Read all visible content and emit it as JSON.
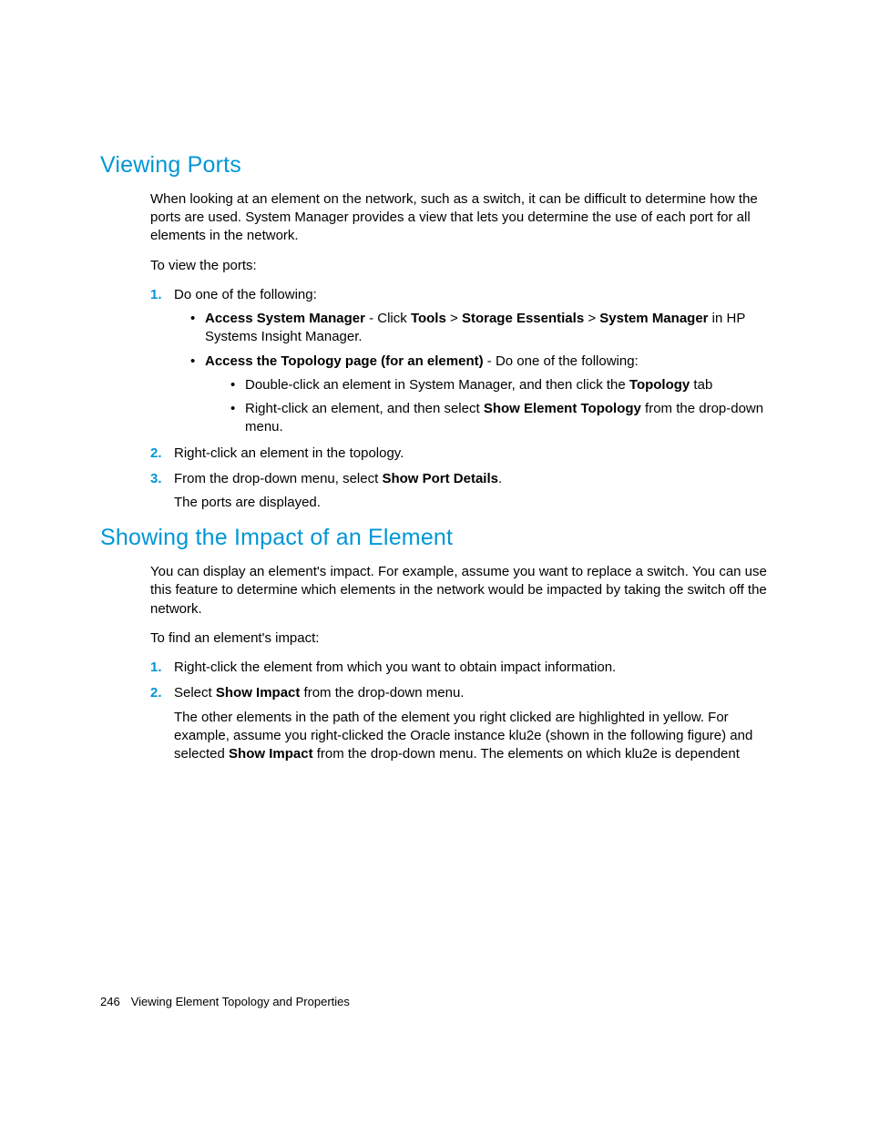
{
  "sections": {
    "viewingPorts": {
      "heading": "Viewing Ports",
      "intro": "When looking at an element on the network, such as a switch, it can be difficult to determine how the ports are used. System Manager provides a view that lets you determine the use of each port for all elements in the network.",
      "lead": "To view the ports:",
      "steps": {
        "s1": {
          "num": "1.",
          "text": "Do one of the following:",
          "bullets": {
            "b1": {
              "boldLead": "Access System Manager",
              "pre": " - Click ",
              "bold2": "Tools",
              "mid1": " > ",
              "bold3": "Storage Essentials",
              "mid2": " > ",
              "bold4": "System Manager",
              "tail": " in HP Systems Insight Manager."
            },
            "b2": {
              "boldLead": "Access the Topology page (for an element)",
              "tail": " - Do one of the following:",
              "inner": {
                "i1": {
                  "pre": "Double-click an element in System Manager, and then click the ",
                  "bold": "Topology",
                  "post": " tab"
                },
                "i2": {
                  "pre": "Right-click an element, and then select ",
                  "bold": "Show Element Topology",
                  "post": " from the drop-down menu."
                }
              }
            }
          }
        },
        "s2": {
          "num": "2.",
          "text": "Right-click an element in the topology."
        },
        "s3": {
          "num": "3.",
          "pre": "From the drop-down menu, select ",
          "bold": "Show Port Details",
          "post": ".",
          "after": "The ports are displayed."
        }
      }
    },
    "showingImpact": {
      "heading": "Showing the Impact of an Element",
      "intro": "You can display an element's impact. For example, assume you want to replace a switch. You can use this feature to determine which elements in the network would be impacted by taking the switch off the network.",
      "lead": "To find an element's impact:",
      "steps": {
        "s1": {
          "num": "1.",
          "text": "Right-click the element from which you want to obtain impact information."
        },
        "s2": {
          "num": "2.",
          "pre": "Select ",
          "bold": "Show Impact",
          "post": " from the drop-down menu.",
          "afterPre": "The other elements in the path of the element you right clicked are highlighted in yellow. For example, assume you right-clicked the Oracle instance klu2e (shown in the following figure) and selected ",
          "afterBold": "Show Impact",
          "afterPost": " from the drop-down menu. The elements on which klu2e is dependent"
        }
      }
    }
  },
  "footer": {
    "pageNumber": "246",
    "chapter": "Viewing Element Topology and Properties"
  }
}
